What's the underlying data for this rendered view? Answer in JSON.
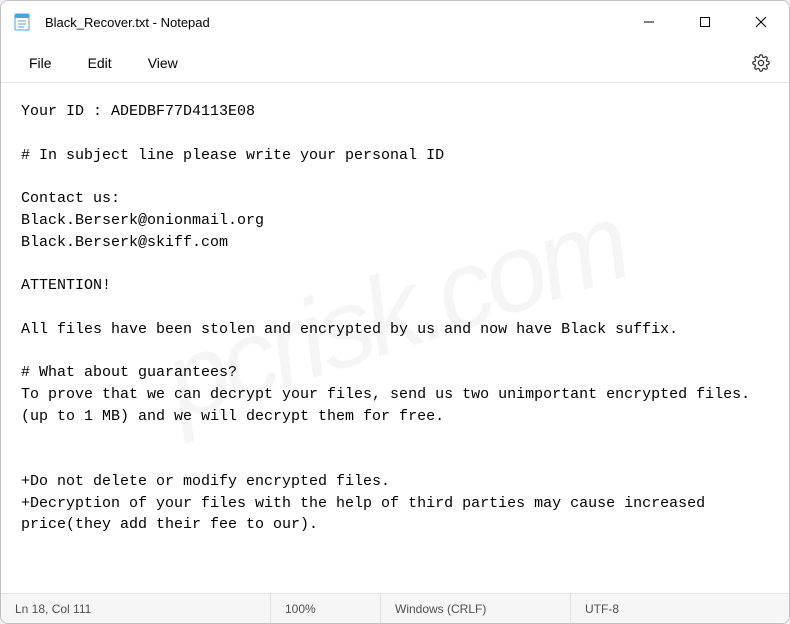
{
  "titlebar": {
    "title": "Black_Recover.txt - Notepad"
  },
  "menu": {
    "file": "File",
    "edit": "Edit",
    "view": "View"
  },
  "content": {
    "text": "Your ID : ADEDBF77D4113E08\n\n# In subject line please write your personal ID\n\nContact us:\nBlack.Berserk@onionmail.org\nBlack.Berserk@skiff.com\n\nATTENTION!\n\nAll files have been stolen and encrypted by us and now have Black suffix.\n\n# What about guarantees?\nTo prove that we can decrypt your files, send us two unimportant encrypted files.(up to 1 MB) and we will decrypt them for free.\n\n\n+Do not delete or modify encrypted files.\n+Decryption of your files with the help of third parties may cause increased price(they add their fee to our)."
  },
  "statusbar": {
    "position": "Ln 18, Col 111",
    "zoom": "100%",
    "eol": "Windows (CRLF)",
    "encoding": "UTF-8"
  },
  "watermark": "pcrisk.com"
}
